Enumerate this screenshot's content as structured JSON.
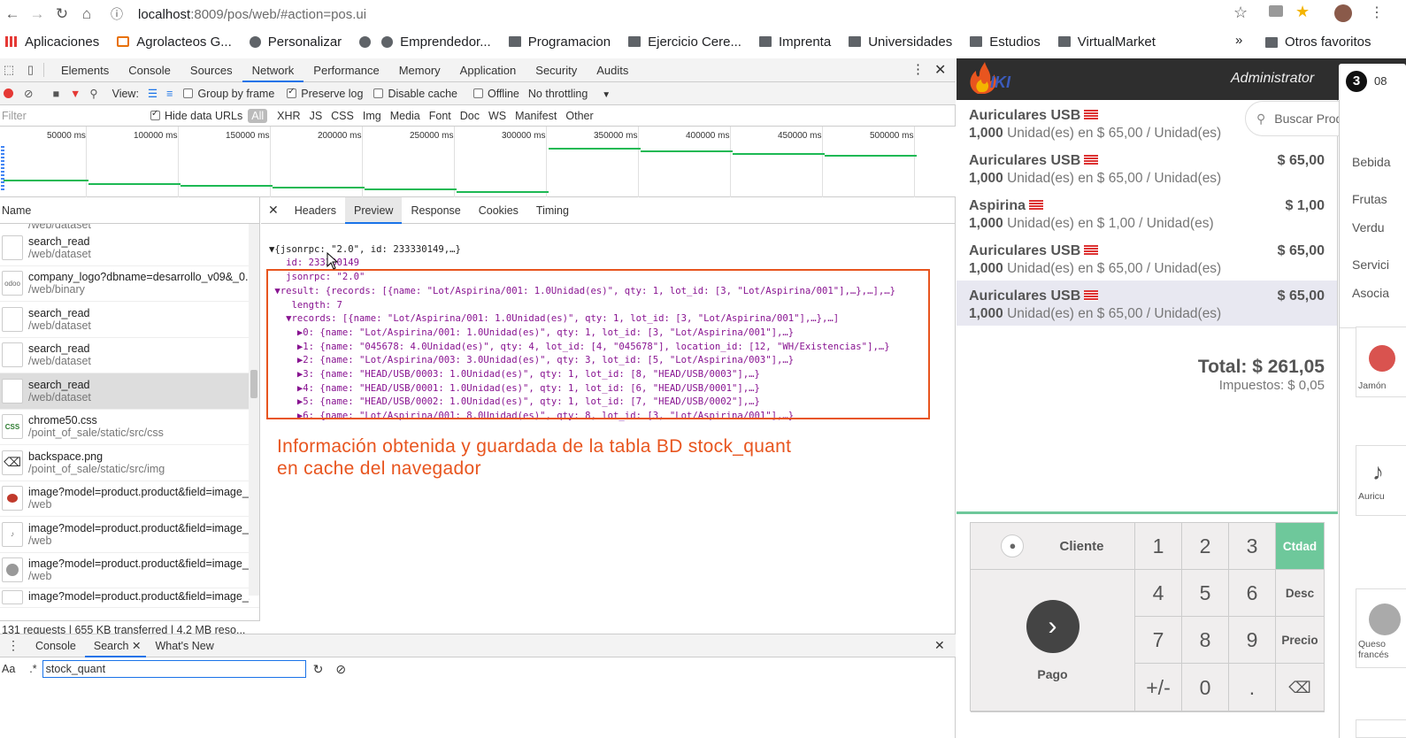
{
  "browser": {
    "url_host": "localhost",
    "url_path": ":8009/pos/web/#action=pos.ui"
  },
  "bookmarks": [
    "Aplicaciones",
    "Agrolacteos G...",
    "Personalizar",
    "Emprendedor...",
    "Programacion",
    "Ejercicio Cere...",
    "Imprenta",
    "Universidades",
    "Estudios",
    "VirtualMarket"
  ],
  "bookmarks_more": "»",
  "bookmarks_other": "Otros favoritos",
  "devtools": {
    "tabs": [
      "Elements",
      "Console",
      "Sources",
      "Network",
      "Performance",
      "Memory",
      "Application",
      "Security",
      "Audits"
    ],
    "active_tab": "Network",
    "toolbar": {
      "view": "View:",
      "group_by_frame": "Group by frame",
      "preserve_log": "Preserve log",
      "disable_cache": "Disable cache",
      "offline": "Offline",
      "throttling": "No throttling"
    },
    "filter": {
      "placeholder": "Filter",
      "hide_data_urls": "Hide data URLs",
      "types": [
        "All",
        "XHR",
        "JS",
        "CSS",
        "Img",
        "Media",
        "Font",
        "Doc",
        "WS",
        "Manifest",
        "Other"
      ]
    },
    "timeline_labels": [
      "50000 ms",
      "100000 ms",
      "150000 ms",
      "200000 ms",
      "250000 ms",
      "300000 ms",
      "350000 ms",
      "400000 ms",
      "450000 ms",
      "500000 ms"
    ],
    "list_header": "Name",
    "requests": [
      {
        "name": "search_read",
        "path": "/web/dataset",
        "icon": ""
      },
      {
        "name": "company_logo?dbname=desarrollo_v09&_0.0...",
        "path": "/web/binary",
        "icon": "odoo"
      },
      {
        "name": "search_read",
        "path": "/web/dataset",
        "icon": ""
      },
      {
        "name": "search_read",
        "path": "/web/dataset",
        "icon": ""
      },
      {
        "name": "search_read",
        "path": "/web/dataset",
        "icon": ""
      },
      {
        "name": "chrome50.css",
        "path": "/point_of_sale/static/src/css",
        "icon": "CSS"
      },
      {
        "name": "backspace.png",
        "path": "/point_of_sale/static/src/img",
        "icon": "⌫"
      },
      {
        "name": "image?model=product.product&field=image_...",
        "path": "/web",
        "icon": ""
      },
      {
        "name": "image?model=product.product&field=image_...",
        "path": "/web",
        "icon": ""
      },
      {
        "name": "image?model=product.product&field=image_...",
        "path": "/web",
        "icon": ""
      },
      {
        "name": "image?model=product.product&field=image_...",
        "path": "",
        "icon": ""
      }
    ],
    "first_partial_path": "/web/dataset",
    "status": "131 requests  |  655 KB transferred  |  4.2 MB reso...",
    "preview_tabs": [
      "Headers",
      "Preview",
      "Response",
      "Cookies",
      "Timing"
    ],
    "active_preview": "Preview",
    "json_lines": [
      "▼{jsonrpc: \"2.0\", id: 233330149,…}",
      "   id: 233330149",
      "   jsonrpc: \"2.0\"",
      " ▼result: {records: [{name: \"Lot/Aspirina/001: 1.0Unidad(es)\", qty: 1, lot_id: [3, \"Lot/Aspirina/001\"],…},…],…}",
      "    length: 7",
      "   ▼records: [{name: \"Lot/Aspirina/001: 1.0Unidad(es)\", qty: 1, lot_id: [3, \"Lot/Aspirina/001\"],…},…]",
      "     ▶0: {name: \"Lot/Aspirina/001: 1.0Unidad(es)\", qty: 1, lot_id: [3, \"Lot/Aspirina/001\"],…}",
      "     ▶1: {name: \"045678: 4.0Unidad(es)\", qty: 4, lot_id: [4, \"045678\"], location_id: [12, \"WH/Existencias\"],…}",
      "     ▶2: {name: \"Lot/Aspirina/003: 3.0Unidad(es)\", qty: 3, lot_id: [5, \"Lot/Aspirina/003\"],…}",
      "     ▶3: {name: \"HEAD/USB/0003: 1.0Unidad(es)\", qty: 1, lot_id: [8, \"HEAD/USB/0003\"],…}",
      "     ▶4: {name: \"HEAD/USB/0001: 1.0Unidad(es)\", qty: 1, lot_id: [6, \"HEAD/USB/0001\"],…}",
      "     ▶5: {name: \"HEAD/USB/0002: 1.0Unidad(es)\", qty: 1, lot_id: [7, \"HEAD/USB/0002\"],…}",
      "     ▶6: {name: \"Lot/Aspirina/001: 8.0Unidad(es)\", qty: 8, lot_id: [3, \"Lot/Aspirina/001\"],…}"
    ],
    "annotation_line1": "Información obtenida y guardada de la tabla BD stock_quant",
    "annotation_line2": "en cache del navegador",
    "drawer_tabs": [
      "Console",
      "Search",
      "What's New"
    ],
    "search_value": "stock_quant",
    "search_aa": "Aa",
    "search_regex": ".*"
  },
  "pos": {
    "logo_text": "IKI",
    "user": "Administrator",
    "order_count": "3",
    "order_time": "08",
    "search_placeholder": "Buscar Productos",
    "lines": [
      {
        "name": "Auriculares USB",
        "price": "",
        "qty": "1,000",
        "detail": "Unidad(es) en $ 65,00 / Unidad(es)"
      },
      {
        "name": "Auriculares USB",
        "price": "$ 65,00",
        "qty": "1,000",
        "detail": "Unidad(es) en $ 65,00 / Unidad(es)"
      },
      {
        "name": "Aspirina",
        "price": "$ 1,00",
        "qty": "1,000",
        "detail": "Unidad(es) en $ 1,00 / Unidad(es)"
      },
      {
        "name": "Auriculares USB",
        "price": "$ 65,00",
        "qty": "1,000",
        "detail": "Unidad(es) en $ 65,00 / Unidad(es)"
      },
      {
        "name": "Auriculares USB",
        "price": "$ 65,00",
        "qty": "1,000",
        "detail": "Unidad(es) en $ 65,00 / Unidad(es)"
      }
    ],
    "total": "Total: $ 261,05",
    "taxes": "Impuestos: $ 0,05",
    "customer": "Cliente",
    "payment": "Pago",
    "keys": [
      "1",
      "2",
      "3",
      "4",
      "5",
      "6",
      "7",
      "8",
      "9",
      "+/-",
      "0",
      "."
    ],
    "modes": [
      "Ctdad",
      "Desc",
      "Precio"
    ],
    "categories": [
      "Bebida",
      "Frutas",
      "Verdu",
      "Servici",
      "Asocia"
    ],
    "products": [
      "Jamón",
      "Auricu",
      "Queso francés"
    ]
  }
}
